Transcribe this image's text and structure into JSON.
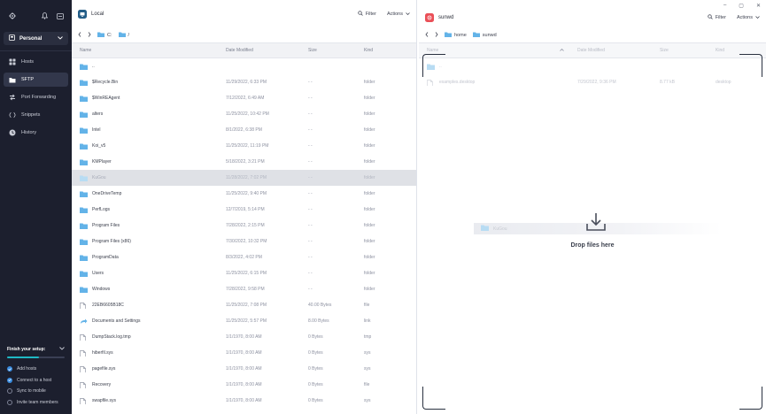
{
  "sidebar": {
    "vault_label": "Personal",
    "nav": [
      {
        "label": "Hosts",
        "icon": "hosts-icon"
      },
      {
        "label": "SFTP",
        "icon": "sftp-icon",
        "active": true
      },
      {
        "label": "Port Forwarding",
        "icon": "port-forwarding-icon"
      },
      {
        "label": "Snippets",
        "icon": "snippets-icon"
      },
      {
        "label": "History",
        "icon": "history-icon"
      }
    ],
    "setup": {
      "title": "Finish your setup:",
      "progress": 0.55,
      "tasks": [
        {
          "label": "Add hosts",
          "done": true
        },
        {
          "label": "Connect to a host",
          "done": true
        },
        {
          "label": "Sync to mobile",
          "done": false
        },
        {
          "label": "Invite team members",
          "done": false
        }
      ]
    }
  },
  "colors": {
    "sidebar_bg": "#1c1f2e",
    "local_badge": "#235d87",
    "remote_badge": "#ea4f57",
    "folder": "#63b3e8",
    "accent": "#3a8de0"
  },
  "local": {
    "title": "Local",
    "filter_label": "Filter",
    "actions_label": "Actions",
    "path": [
      "C:",
      "/"
    ],
    "columns": {
      "name": "Name",
      "date": "Date Modified",
      "size": "Size",
      "kind": "Kind"
    },
    "rows": [
      {
        "name": "..",
        "date": "",
        "size": "",
        "kind": "",
        "type": "folder"
      },
      {
        "name": "$Recycle.Bin",
        "date": "11/29/2022, 6:33 PM",
        "size": "- -",
        "kind": "folder",
        "type": "folder"
      },
      {
        "name": "$WinREAgent",
        "date": "7/12/2022, 6:49 AM",
        "size": "- -",
        "kind": "folder",
        "type": "folder"
      },
      {
        "name": "alters",
        "date": "11/25/2022, 10:42 PM",
        "size": "- -",
        "kind": "folder",
        "type": "folder"
      },
      {
        "name": "Intel",
        "date": "8/1/2022, 6:38 PM",
        "size": "- -",
        "kind": "folder",
        "type": "folder"
      },
      {
        "name": "Koi_v5",
        "date": "11/25/2022, 11:19 PM",
        "size": "- -",
        "kind": "folder",
        "type": "folder"
      },
      {
        "name": "KMPlayer",
        "date": "5/18/2022, 3:21 PM",
        "size": "- -",
        "kind": "folder",
        "type": "folder"
      },
      {
        "name": "KuGou",
        "date": "11/28/2022, 7:02 PM",
        "size": "- -",
        "kind": "folder",
        "type": "folder",
        "selected": true
      },
      {
        "name": "OneDriveTemp",
        "date": "11/25/2022, 9:40 PM",
        "size": "- -",
        "kind": "folder",
        "type": "folder"
      },
      {
        "name": "PerfLogs",
        "date": "12/7/2019, 5:14 PM",
        "size": "- -",
        "kind": "folder",
        "type": "folder"
      },
      {
        "name": "Program Files",
        "date": "7/28/2022, 2:15 PM",
        "size": "- -",
        "kind": "folder",
        "type": "folder"
      },
      {
        "name": "Program Files (x86)",
        "date": "7/30/2022, 10:32 PM",
        "size": "- -",
        "kind": "folder",
        "type": "folder"
      },
      {
        "name": "ProgramData",
        "date": "8/3/2022, 4:02 PM",
        "size": "- -",
        "kind": "folder",
        "type": "folder"
      },
      {
        "name": "Users",
        "date": "11/25/2022, 6:15 PM",
        "size": "- -",
        "kind": "folder",
        "type": "folder"
      },
      {
        "name": "Windows",
        "date": "7/28/2022, 9:58 PM",
        "size": "- -",
        "kind": "folder",
        "type": "folder"
      },
      {
        "name": "22EB6605B18C",
        "date": "11/25/2022, 7:08 PM",
        "size": "40.00 Bytes",
        "kind": "file",
        "type": "file"
      },
      {
        "name": "Documents and Settings",
        "date": "11/25/2022, 5:57 PM",
        "size": "8.00 Bytes",
        "kind": "link",
        "type": "link"
      },
      {
        "name": "DumpStack.log.tmp",
        "date": "1/1/1970, 8:00 AM",
        "size": "0 Bytes",
        "kind": "tmp",
        "type": "file"
      },
      {
        "name": "hiberfil.sys",
        "date": "1/1/1970, 8:00 AM",
        "size": "0 Bytes",
        "kind": "sys",
        "type": "file"
      },
      {
        "name": "pagefile.sys",
        "date": "1/1/1970, 8:00 AM",
        "size": "0 Bytes",
        "kind": "sys",
        "type": "file"
      },
      {
        "name": "Recovery",
        "date": "1/1/1970, 8:00 AM",
        "size": "0 Bytes",
        "kind": "file",
        "type": "file"
      },
      {
        "name": "swapfile.sys",
        "date": "1/1/1970, 8:00 AM",
        "size": "0 Bytes",
        "kind": "sys",
        "type": "file"
      }
    ]
  },
  "remote": {
    "title": "sunwd",
    "filter_label": "Filter",
    "actions_label": "Actions",
    "path": [
      "home",
      "sunwd"
    ],
    "columns": {
      "name": "Name",
      "date": "Date Modified",
      "size": "Size",
      "kind": "Kind"
    },
    "rows": [
      {
        "name": "..",
        "sub": "",
        "date": "",
        "size": "",
        "kind": "",
        "type": "folder"
      },
      {
        "name": "examples.desktop",
        "sub": "",
        "date": "7/29/2022, 9:36 PM",
        "size": "8.77 kB",
        "kind": "desktop",
        "type": "file"
      }
    ],
    "drag_ghost": "KuGou",
    "drop_text": "Drop files here"
  }
}
